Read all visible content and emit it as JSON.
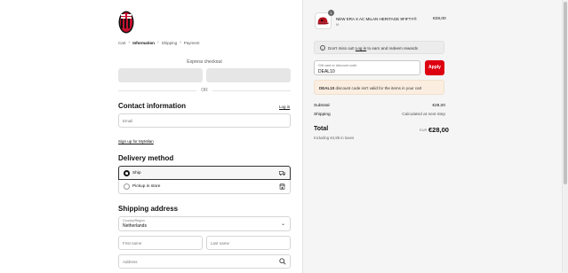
{
  "breadcrumb": {
    "items": [
      "Cart",
      "Information",
      "Shipping",
      "Payment"
    ],
    "separator": ">"
  },
  "express_checkout": {
    "title": "Express checkout",
    "or_label": "OR"
  },
  "contact": {
    "title": "Contact information",
    "login_label": "Log in",
    "email_placeholder": "Email",
    "signup_label": "Sign up for MyMilan"
  },
  "delivery": {
    "title": "Delivery method",
    "options": [
      {
        "label": "Ship",
        "icon": "truck-icon",
        "selected": true
      },
      {
        "label": "Pickup in store",
        "icon": "store-icon",
        "selected": false
      }
    ]
  },
  "shipping": {
    "title": "Shipping address",
    "country_label": "Country/Region",
    "country_value": "Netherlands",
    "first_name_placeholder": "First name",
    "last_name_placeholder": "Last name",
    "address_placeholder": "Address"
  },
  "order": {
    "product": {
      "name": "NEW ERA X AC MILAN HERITAGE 9FIFTY®",
      "variant": "M",
      "quantity": "1",
      "price": "€28,00"
    },
    "rewards": {
      "prefix": "Don't miss out!",
      "link": "Log in",
      "suffix": "to earn and redeem rewards"
    },
    "discount": {
      "label": "Gift card or discount code",
      "value": "DEAL10",
      "apply_label": "Apply",
      "error_code": "DEAL10",
      "error_text": "discount code isn't valid for the items in your cart"
    },
    "summary": {
      "subtotal_label": "Subtotal",
      "subtotal_value": "€28,00",
      "shipping_label": "Shipping",
      "shipping_value": "Calculated at next step",
      "total_label": "Total",
      "total_currency": "EUR",
      "total_value": "€28,00",
      "taxes_note": "Including €4,86 in taxes"
    }
  },
  "colors": {
    "accent": "#dd0011",
    "notice_bg": "#fbeee0",
    "panel_bg": "#f5f5f5"
  }
}
